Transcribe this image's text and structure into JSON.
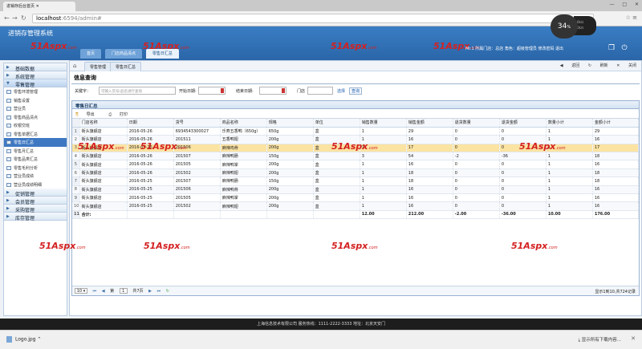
{
  "browser": {
    "tab_title": "进销存后台首页",
    "url_host": "localhost",
    "url_path": ":6594/admin#",
    "speed_value": "34",
    "speed_unit": "%",
    "speed_side_up": "0k/s",
    "speed_side_down": "0k/s"
  },
  "app": {
    "title": "进销存管理系统",
    "header_info": "Mr.1 所属门店：总店  角色：超级管理员  修改密码  退出",
    "watermark_text": "51Aspx",
    "watermark_suffix": ".com"
  },
  "module_tabs": [
    {
      "label": "首页",
      "active": false
    },
    {
      "label": "门店商品清点",
      "active": false
    },
    {
      "label": "零售日汇总",
      "active": true
    }
  ],
  "sidebar": {
    "sections_top": [
      {
        "label": "基础数据"
      },
      {
        "label": "系统管理"
      }
    ],
    "open_section": "零售管理",
    "items": [
      {
        "label": "零售环境管理",
        "active": false
      },
      {
        "label": "销售设置",
        "active": false
      },
      {
        "label": "营业员",
        "active": false
      },
      {
        "label": "零售商品清点",
        "active": false
      },
      {
        "label": "收银交班",
        "active": false
      },
      {
        "label": "零售单据汇总",
        "active": false
      },
      {
        "label": "零售日汇总",
        "active": true
      },
      {
        "label": "零售月汇总",
        "active": false
      },
      {
        "label": "零售品类汇总",
        "active": false
      },
      {
        "label": "零售毛利分析",
        "active": false
      },
      {
        "label": "营业员成绩",
        "active": false
      },
      {
        "label": "营业员成绩明细",
        "active": false
      }
    ],
    "sections_bottom": [
      {
        "label": "促销管理"
      },
      {
        "label": "会员管理"
      },
      {
        "label": "采购管理"
      },
      {
        "label": "库存管理"
      }
    ]
  },
  "crumbs": {
    "tab1": "零售管理",
    "tab2": "零售日汇总",
    "back": "返回",
    "refresh": "刷新",
    "close": "关闭"
  },
  "query": {
    "title": "信息查询",
    "keyword_label": "关键字：",
    "keyword_placeholder": "可输入货号/品名进行查询",
    "start_label": "开始日期:",
    "end_label": "结束日期:",
    "store_label": "门店",
    "select_label": "选择",
    "search_label": "查询"
  },
  "grid": {
    "title": "零售日汇总",
    "export_label": "导出",
    "print_label": "打印",
    "columns": [
      "门店名称",
      "日期",
      "货号",
      "商品名称",
      "规格",
      "单位",
      "销售数量",
      "销售金额",
      "退货数量",
      "退货金额",
      "数量小计",
      "金额小计"
    ],
    "rows": [
      [
        "1",
        "街头旗舰店",
        "2016-05-26",
        "6934543300027",
        "乐寿五香鸭（650g）",
        "650g",
        "盒",
        "1",
        "29",
        "0",
        "0",
        "1",
        "29"
      ],
      [
        "2",
        "街头旗舰店",
        "2016-05-26",
        "201511",
        "五香鸭翅",
        "200g",
        "盒",
        "1",
        "16",
        "0",
        "0",
        "1",
        "16"
      ],
      [
        "3",
        "街头旗舰店",
        "2016-05-26",
        "201506",
        "麻辣鸡骨",
        "200g",
        "盒",
        "1",
        "17",
        "0",
        "0",
        "1",
        "17"
      ],
      [
        "4",
        "街头旗舰店",
        "2016-05-26",
        "201507",
        "麻辣鸭肠",
        "150g",
        "盒",
        "3",
        "54",
        "-2",
        "-36",
        "1",
        "18"
      ],
      [
        "5",
        "街头旗舰店",
        "2016-05-26",
        "201505",
        "麻辣鸭掌",
        "200g",
        "盒",
        "1",
        "16",
        "0",
        "0",
        "1",
        "16"
      ],
      [
        "6",
        "街头旗舰店",
        "2016-05-26",
        "201502",
        "麻辣鸭翅",
        "200g",
        "盒",
        "1",
        "18",
        "0",
        "0",
        "1",
        "18"
      ],
      [
        "7",
        "街头旗舰店",
        "2016-05-25",
        "201507",
        "麻辣鸭肠",
        "150g",
        "盒",
        "1",
        "18",
        "0",
        "0",
        "1",
        "18"
      ],
      [
        "8",
        "街头旗舰店",
        "2016-05-25",
        "201506",
        "麻辣鸭骨",
        "200g",
        "盒",
        "1",
        "16",
        "0",
        "0",
        "1",
        "16"
      ],
      [
        "9",
        "街头旗舰店",
        "2016-05-25",
        "201505",
        "麻辣鸭掌",
        "200g",
        "盒",
        "1",
        "16",
        "0",
        "0",
        "1",
        "16"
      ],
      [
        "10",
        "街头旗舰店",
        "2016-05-25",
        "201502",
        "麻辣鸭翅",
        "200g",
        "盒",
        "1",
        "16",
        "0",
        "0",
        "1",
        "16"
      ]
    ],
    "highlight_row": 2,
    "summary": {
      "rn": "11",
      "label": "合计:",
      "sale_qty": "12.00",
      "sale_amt": "212.00",
      "ret_qty": "-2.00",
      "ret_amt": "-36.00",
      "qty_sub": "10.00",
      "amt_sub": "176.00"
    }
  },
  "pager": {
    "page_size": "10",
    "page_prefix": "第",
    "page_current": "1",
    "page_total": "共7页",
    "info": "显示1到10,共724记录"
  },
  "footer": {
    "text": "上海信息技术有限公司  服务热线：1111-2222-3333 地址：北京天安门"
  },
  "download": {
    "file": "Logo.jpg",
    "show_all": "显示所有下载内容..."
  }
}
